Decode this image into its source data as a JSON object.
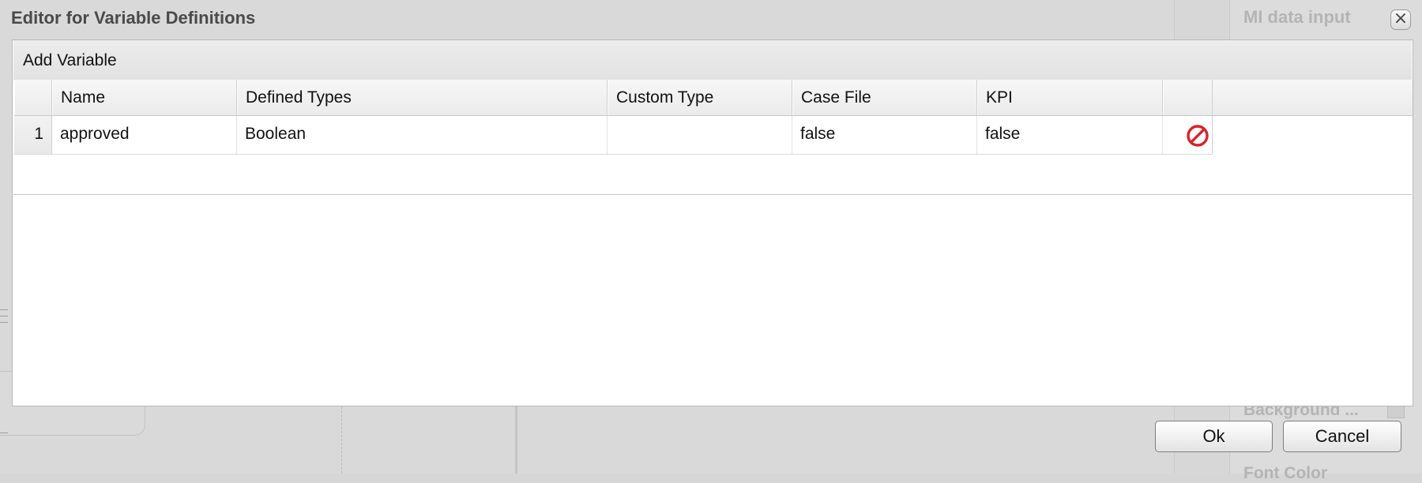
{
  "dialog": {
    "title": "Editor for Variable Definitions",
    "close_glyph": "×"
  },
  "background": {
    "right_title": "MI data input",
    "right_label_1": "Background ...",
    "right_label_2": "Font Color"
  },
  "toolbar": {
    "add_label": "Add Variable"
  },
  "table": {
    "headers": {
      "name": "Name",
      "defined_types": "Defined Types",
      "custom_type": "Custom Type",
      "case_file": "Case File",
      "kpi": "KPI"
    },
    "rows": [
      {
        "index": "1",
        "name": "approved",
        "defined_type": "Boolean",
        "custom_type": "",
        "case_file": "false",
        "kpi": "false",
        "delete_icon": "delete-icon"
      }
    ]
  },
  "footer": {
    "ok_label": "Ok",
    "cancel_label": "Cancel"
  },
  "colors": {
    "delete_icon": "#d8232a"
  }
}
